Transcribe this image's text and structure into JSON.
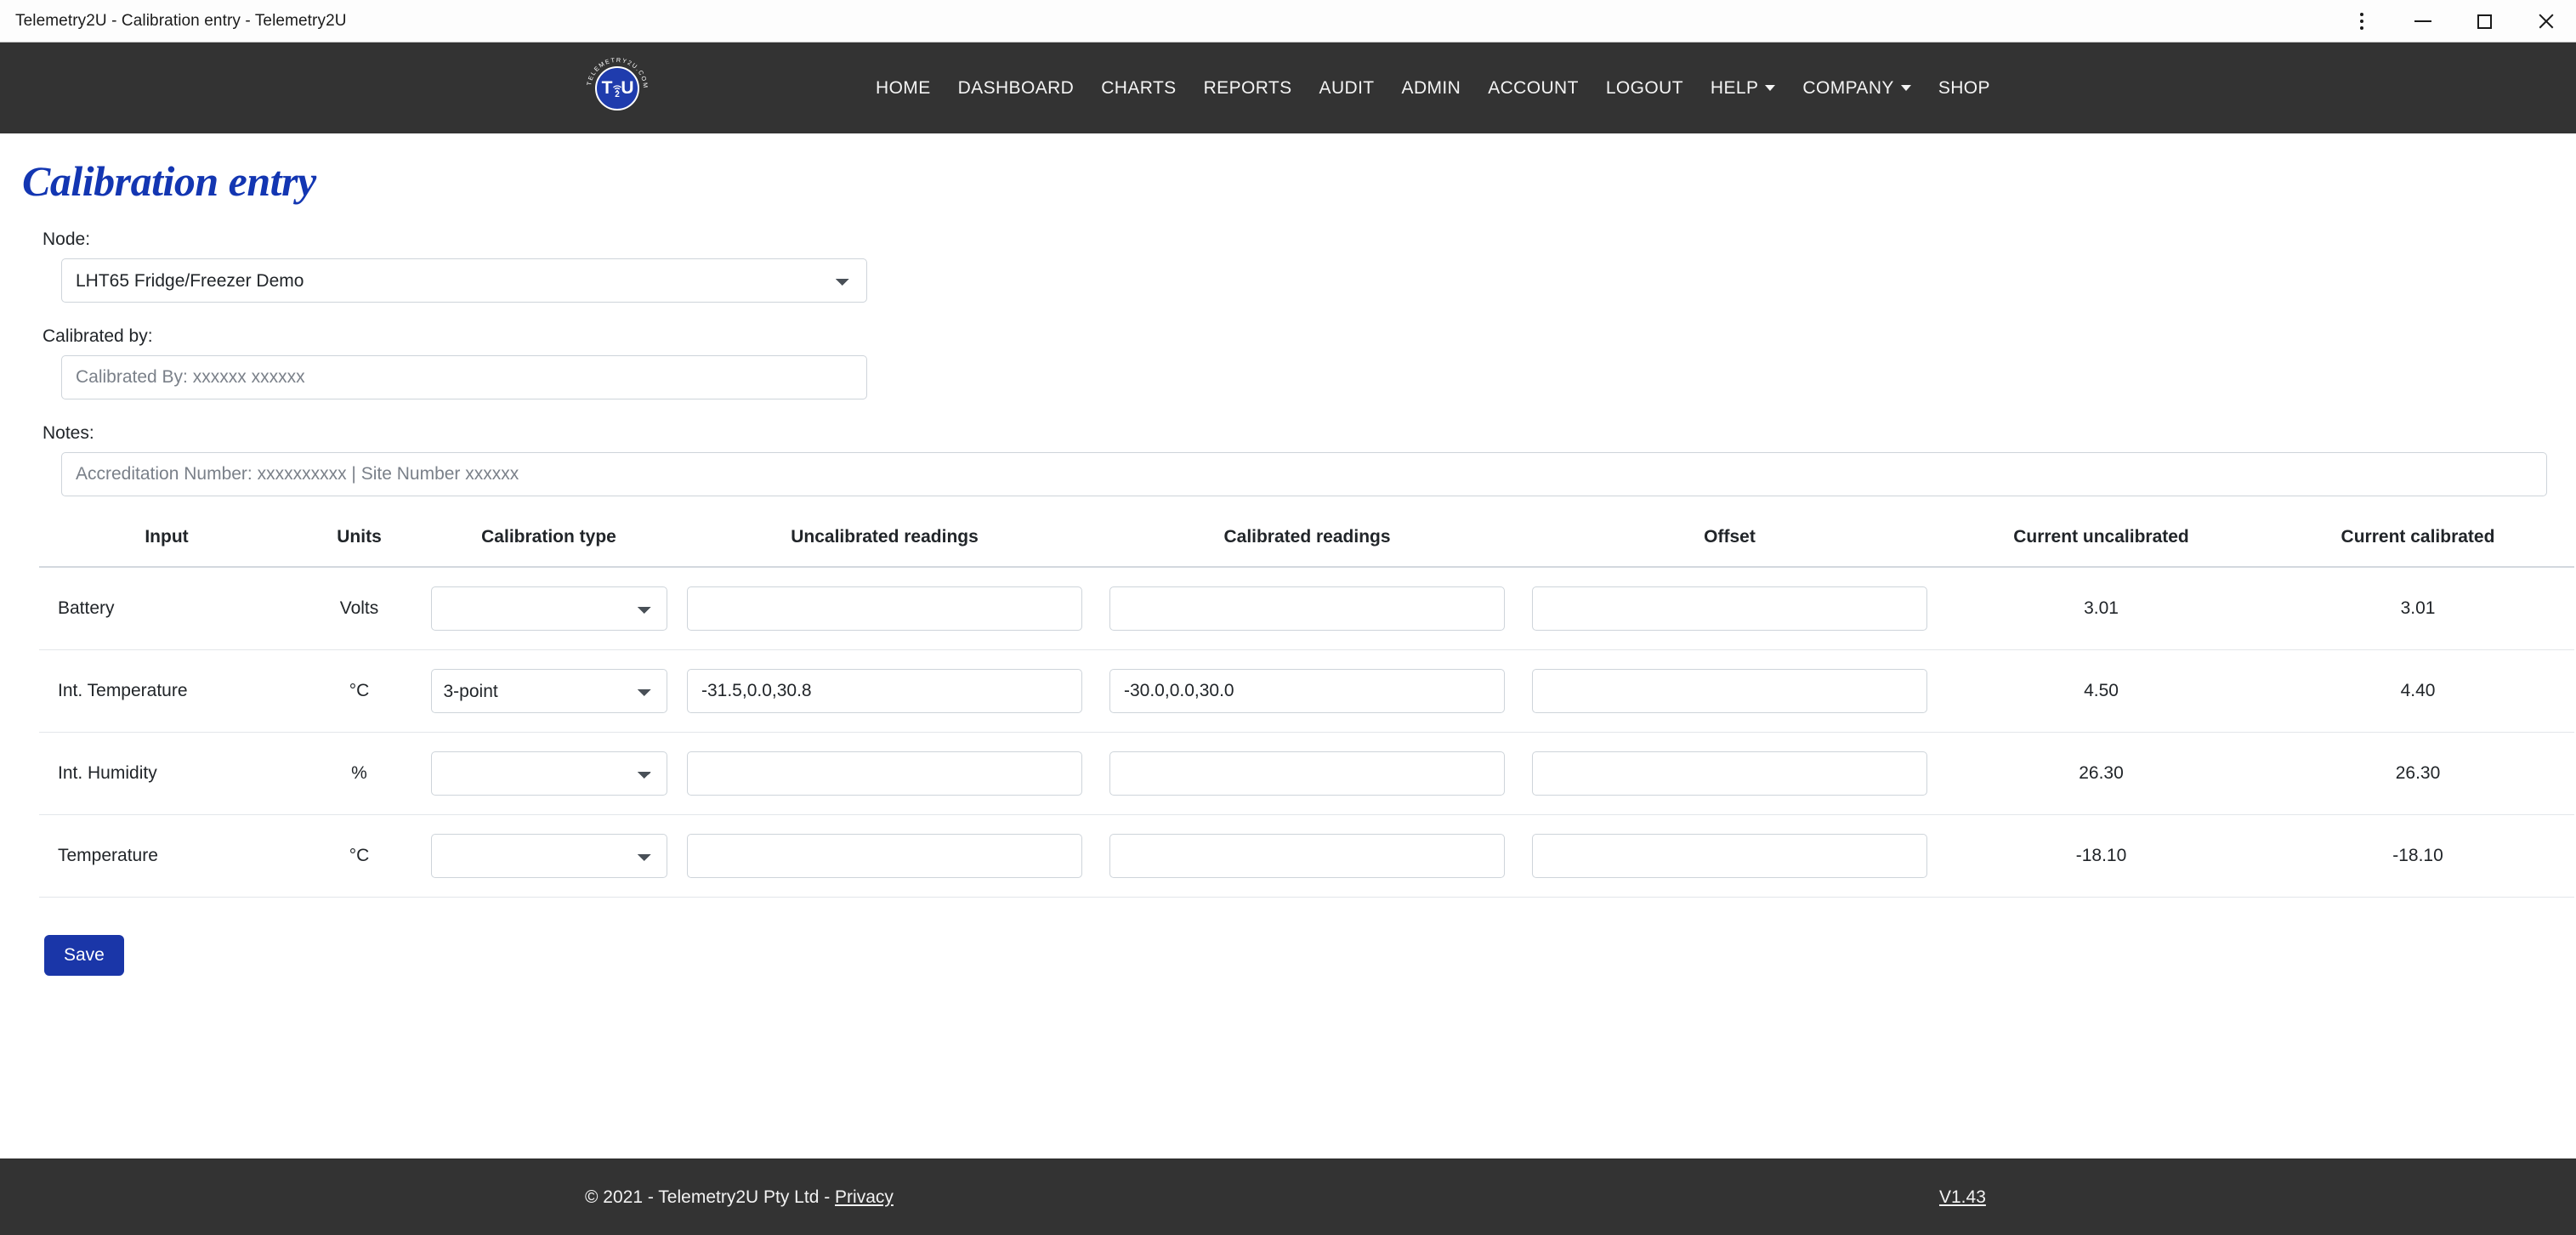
{
  "window": {
    "title": "Telemetry2U - Calibration entry - Telemetry2U",
    "controls": {
      "menu": "⋮",
      "minimize": "—",
      "maximize": "□",
      "close": "✕"
    }
  },
  "nav": {
    "logo_alt": "TELEMETRY2U.COM",
    "logo_text_center": "T2U",
    "logo_ring_text": "TELEMETRY2U.COM",
    "items": [
      {
        "label": "HOME",
        "dropdown": false
      },
      {
        "label": "DASHBOARD",
        "dropdown": false
      },
      {
        "label": "CHARTS",
        "dropdown": false
      },
      {
        "label": "REPORTS",
        "dropdown": false
      },
      {
        "label": "AUDIT",
        "dropdown": false
      },
      {
        "label": "ADMIN",
        "dropdown": false
      },
      {
        "label": "ACCOUNT",
        "dropdown": false
      },
      {
        "label": "LOGOUT",
        "dropdown": false
      },
      {
        "label": "HELP",
        "dropdown": true
      },
      {
        "label": "COMPANY",
        "dropdown": true
      },
      {
        "label": "SHOP",
        "dropdown": false
      }
    ]
  },
  "page": {
    "title": "Calibration entry",
    "node": {
      "label": "Node:",
      "selected": "LHT65 Fridge/Freezer Demo"
    },
    "calibrated_by": {
      "label": "Calibrated by:",
      "value": "",
      "placeholder": "Calibrated By: xxxxxx xxxxxx"
    },
    "notes": {
      "label": "Notes:",
      "value": "",
      "placeholder": "Accreditation Number: xxxxxxxxxx | Site Number xxxxxx"
    },
    "save_label": "Save"
  },
  "table": {
    "headers": [
      "Input",
      "Units",
      "Calibration type",
      "Uncalibrated readings",
      "Calibrated readings",
      "Offset",
      "Current uncalibrated",
      "Current calibrated"
    ],
    "rows": [
      {
        "input": "Battery",
        "units": "Volts",
        "calibration_type": "",
        "uncalibrated_readings": "",
        "calibrated_readings": "",
        "offset": "",
        "current_uncalibrated": "3.01",
        "current_calibrated": "3.01"
      },
      {
        "input": "Int. Temperature",
        "units": "°C",
        "calibration_type": "3-point",
        "uncalibrated_readings": "-31.5,0.0,30.8",
        "calibrated_readings": "-30.0,0.0,30.0",
        "offset": "",
        "current_uncalibrated": "4.50",
        "current_calibrated": "4.40"
      },
      {
        "input": "Int. Humidity",
        "units": "%",
        "calibration_type": "",
        "uncalibrated_readings": "",
        "calibrated_readings": "",
        "offset": "",
        "current_uncalibrated": "26.30",
        "current_calibrated": "26.30"
      },
      {
        "input": "Temperature",
        "units": "°C",
        "calibration_type": "",
        "uncalibrated_readings": "",
        "calibrated_readings": "",
        "offset": "",
        "current_uncalibrated": "-18.10",
        "current_calibrated": "-18.10"
      }
    ]
  },
  "footer": {
    "copyright": "© 2021 - Telemetry2U Pty Ltd - ",
    "privacy_label": "Privacy",
    "version": "V1.43"
  },
  "colors": {
    "navbar_bg": "#333333",
    "title_blue": "#1336b2",
    "save_blue": "#1a36a8",
    "logo_blue": "#1f3cad"
  }
}
